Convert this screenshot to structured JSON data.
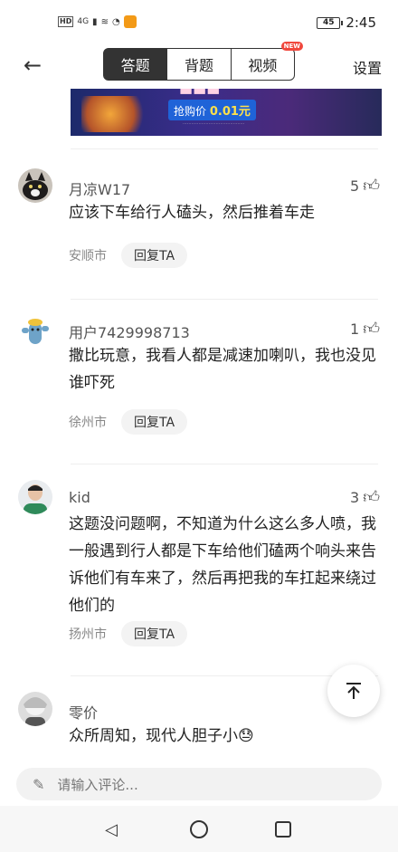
{
  "status_bar": {
    "hd": "HD",
    "network": "4G",
    "time": "2:45",
    "battery": "45"
  },
  "header": {
    "tabs": [
      "答题",
      "背题",
      "视频"
    ],
    "active_tab": "答题",
    "new_badge": "NEW",
    "settings_label": "设置"
  },
  "banner": {
    "price_label": "抢购价",
    "price_value": "0.01元"
  },
  "comments": [
    {
      "username": "月凉W17",
      "likes": "5",
      "text": "应该下车给行人磕头，然后推着车走",
      "location": "安顺市",
      "reply_label": "回复TA"
    },
    {
      "username": "用户7429998713",
      "likes": "1",
      "text": "撒比玩意，我看人都是减速加喇叭，我也没见谁吓死",
      "location": "徐州市",
      "reply_label": "回复TA"
    },
    {
      "username": "kid",
      "likes": "3",
      "text": "这题没问题啊，不知道为什么这么多人喷，我一般遇到行人都是下车给他们磕两个响头来告诉他们有车来了，然后再把我的车扛起来绕过他们的",
      "location": "扬州市",
      "reply_label": "回复TA"
    },
    {
      "username": "零价",
      "likes": "",
      "text": "众所周知，现代人胆子小😓",
      "location": "",
      "reply_label": ""
    }
  ],
  "comment_input": {
    "placeholder": "请输入评论..."
  },
  "icons": {
    "back": "back-arrow-icon",
    "thumb": "thumbs-up-icon",
    "scroll_top": "scroll-to-top-icon",
    "pen": "pen-icon"
  },
  "colors": {
    "active_tab_bg": "#333333",
    "new_badge": "#f0473c",
    "price_highlight": "#ffe14a"
  }
}
